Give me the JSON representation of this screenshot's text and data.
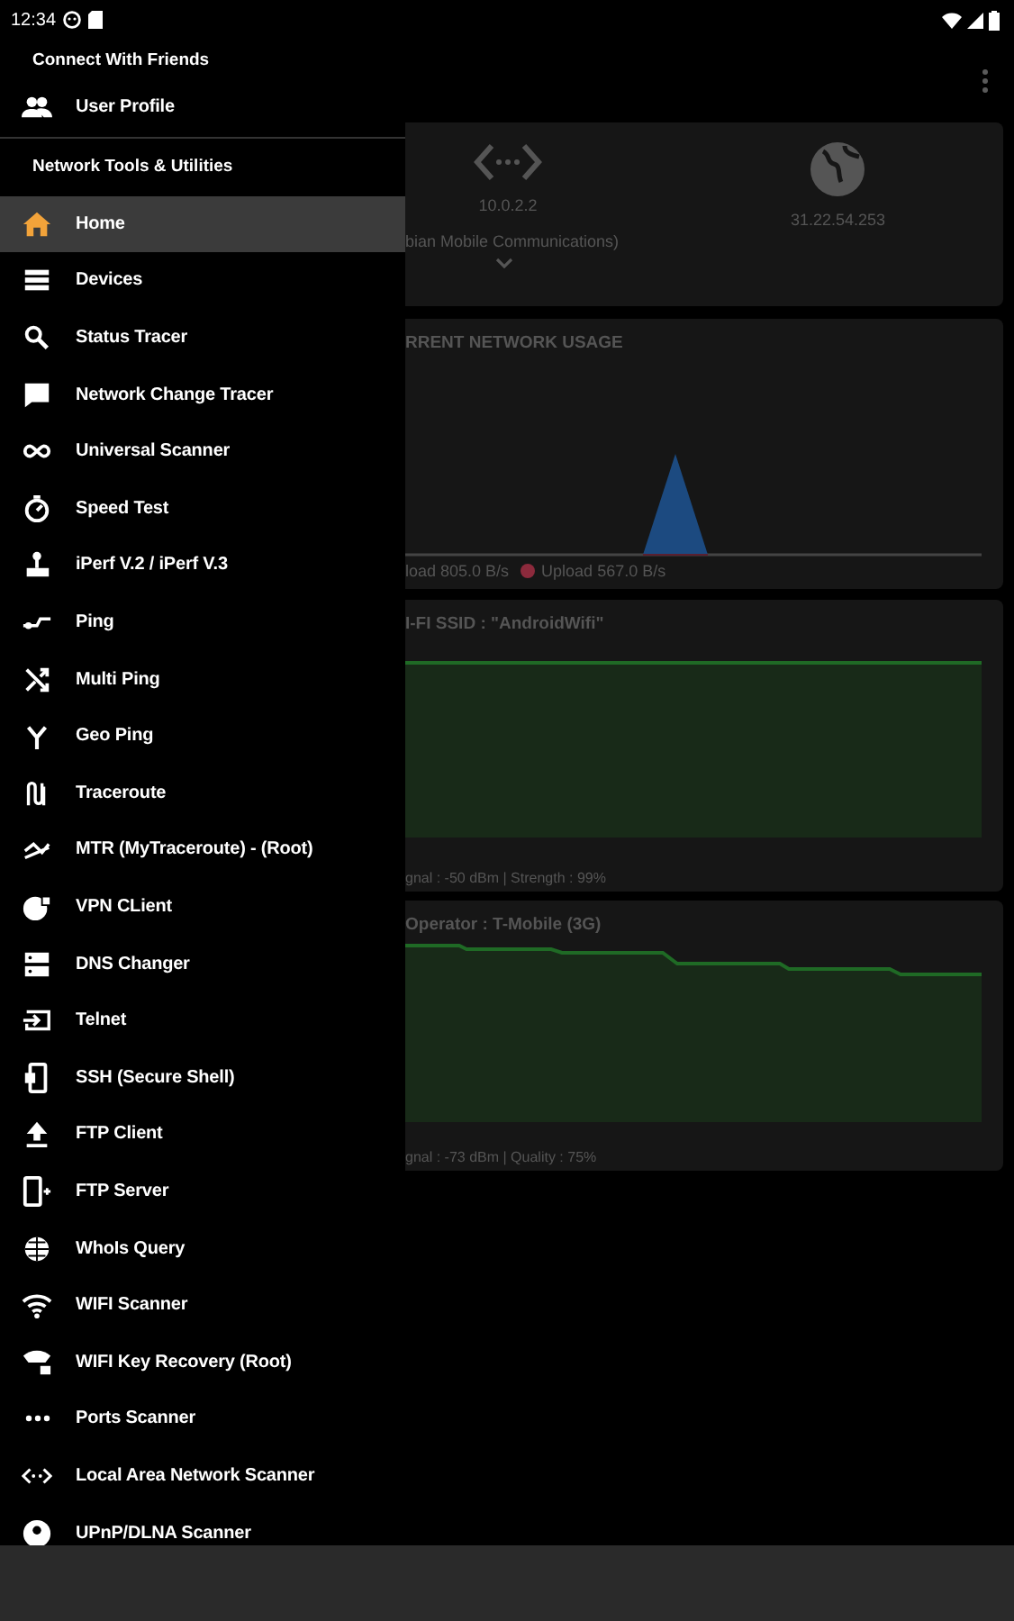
{
  "status_bar": {
    "time": "12:34"
  },
  "drawer": {
    "sections": [
      {
        "title": "Connect With Friends",
        "items": [
          {
            "label": "User Profile",
            "selected": false
          }
        ]
      },
      {
        "title": "Network Tools & Utilities",
        "items": [
          {
            "label": "Home",
            "selected": true
          },
          {
            "label": "Devices",
            "selected": false
          },
          {
            "label": "Status Tracer",
            "selected": false
          },
          {
            "label": "Network Change Tracer",
            "selected": false
          },
          {
            "label": "Universal Scanner",
            "selected": false
          },
          {
            "label": "Speed Test",
            "selected": false
          },
          {
            "label": "iPerf V.2 / iPerf V.3",
            "selected": false
          },
          {
            "label": "Ping",
            "selected": false
          },
          {
            "label": "Multi Ping",
            "selected": false
          },
          {
            "label": "Geo Ping",
            "selected": false
          },
          {
            "label": "Traceroute",
            "selected": false
          },
          {
            "label": "MTR (MyTraceroute) - (Root)",
            "selected": false
          },
          {
            "label": "VPN CLient",
            "selected": false
          },
          {
            "label": "DNS Changer",
            "selected": false
          },
          {
            "label": "Telnet",
            "selected": false
          },
          {
            "label": "SSH (Secure Shell)",
            "selected": false
          },
          {
            "label": "FTP Client",
            "selected": false
          },
          {
            "label": "FTP Server",
            "selected": false
          },
          {
            "label": "WhoIs Query",
            "selected": false
          },
          {
            "label": "WIFI Scanner",
            "selected": false
          },
          {
            "label": "WIFI Key Recovery (Root)",
            "selected": false
          },
          {
            "label": "Ports Scanner",
            "selected": false
          },
          {
            "label": "Local Area Network Scanner",
            "selected": false
          },
          {
            "label": "UPnP/DLNA Scanner",
            "selected": false
          }
        ]
      }
    ]
  },
  "main": {
    "addresses": {
      "local_ip": "10.0.2.2",
      "public_ip": "31.22.54.253",
      "provider": "bian Mobile Communications)"
    },
    "usage": {
      "title": "RRENT NETWORK USAGE",
      "legend": [
        {
          "label": "load 805.0 B/s"
        },
        {
          "label": "Upload 567.0 B/s",
          "color": "#8c2a3c"
        }
      ]
    },
    "wifi": {
      "title": "I-FI SSID : \"AndroidWifi\"",
      "footer": "gnal : -50 dBm  |  Strength : 99%"
    },
    "cellular": {
      "title": "Operator : T-Mobile (3G)",
      "footer": "gnal : -73 dBm  |  Quality : 75%"
    }
  }
}
